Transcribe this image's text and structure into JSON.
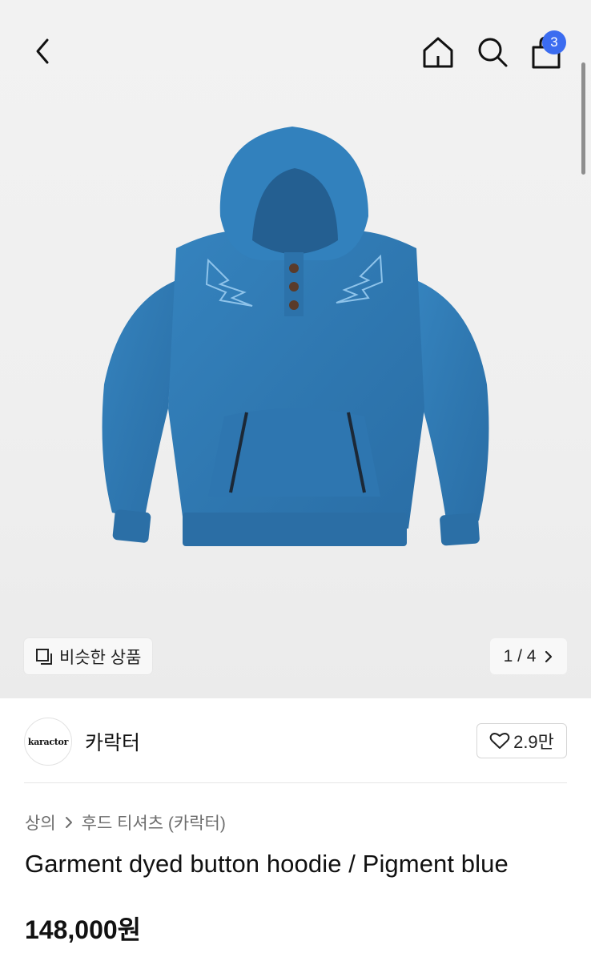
{
  "header": {
    "back_icon": "chevron-left-icon",
    "home_icon": "home-icon",
    "search_icon": "search-icon",
    "cart_icon": "shopping-bag-icon",
    "cart_count": "3",
    "badge_color": "#3b6cf0"
  },
  "gallery": {
    "similar_label": "비슷한 상품",
    "similar_icon": "copy-icon",
    "pager_text": "1 / 4",
    "pager_icon": "chevron-right-icon",
    "product_color": "#2f78b1"
  },
  "shop": {
    "logo_text": "karactor",
    "name": "카락터",
    "likes": "2.9만",
    "like_icon": "heart-icon"
  },
  "product": {
    "breadcrumb": [
      "상의",
      "후드 티셔츠 (카락터)"
    ],
    "title": "Garment dyed button hoodie / Pigment blue",
    "price": "148,000원"
  }
}
